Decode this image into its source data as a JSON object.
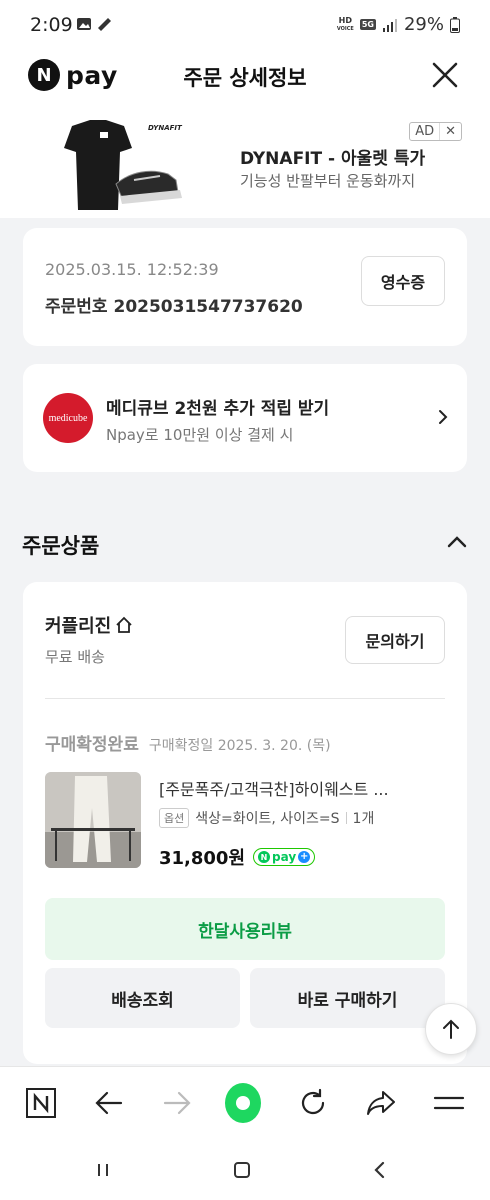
{
  "status_bar": {
    "time": "2:09",
    "battery": "29%",
    "hd_badge": "HD",
    "voice_badge": "VOICE",
    "net_badge": "5G"
  },
  "header": {
    "logo_letter": "N",
    "logo_word": "pay",
    "title": "주문 상세정보"
  },
  "ad": {
    "title": "DYNAFIT - 아울렛 특가",
    "subtitle": "기능성 반팔부터 운동화까지",
    "badge": "AD",
    "badge_close": "✕",
    "brand_mark": "DYNAFIT"
  },
  "order": {
    "datetime": "2025.03.15. 12:52:39",
    "order_label": "주문번호",
    "order_number": "2025031547737620",
    "receipt_button": "영수증"
  },
  "promo": {
    "logo_text": "medicube",
    "title": "메디큐브 2천원 추가 적립 받기",
    "subtitle": "Npay로 10만원 이상 결제 시"
  },
  "section": {
    "title": "주문상품"
  },
  "product": {
    "seller": "커플리진",
    "shipping": "무료 배송",
    "inquiry_button": "문의하기",
    "status": "구매확정완료",
    "status_date": "구매확정일 2025. 3. 20. (목)",
    "name": "[주문폭주/고객극찬]하이웨스트 ...",
    "option_tag": "옵션",
    "option": "색상=화이트, 사이즈=S",
    "quantity": "1개",
    "price": "31,800원",
    "npay_badge": "pay"
  },
  "actions": {
    "review": "한달사용리뷰",
    "tracking": "배송조회",
    "rebuy": "바로 구매하기"
  },
  "colors": {
    "brand_green": "#03c75a",
    "review_bg": "#e8f8ec",
    "review_text": "#0b9c45",
    "medicube_red": "#d41b2c"
  }
}
